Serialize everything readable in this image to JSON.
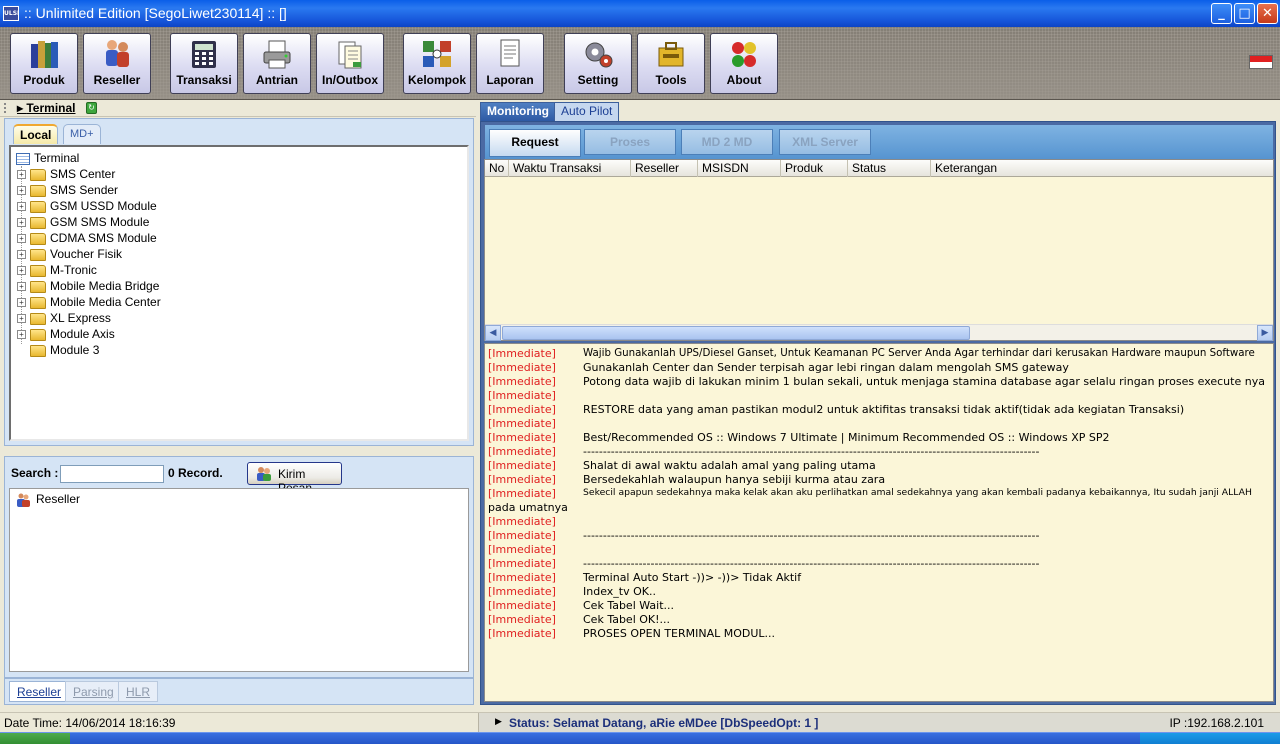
{
  "window": {
    "title": ":: Unlimited Edition [SegoLiwet230114] :: []",
    "app_icon_text": "ULSI",
    "controls": [
      "_",
      "□",
      "✕"
    ]
  },
  "toolbar": {
    "buttons": [
      {
        "label": "Produk",
        "icon": "books-icon"
      },
      {
        "label": "Reseller",
        "icon": "people-icon"
      },
      {
        "label": "Transaksi",
        "icon": "calculator-icon"
      },
      {
        "label": "Antrian",
        "icon": "printer-queue-icon"
      },
      {
        "label": "In/Outbox",
        "icon": "documents-icon"
      },
      {
        "label": "Kelompok",
        "icon": "network-group-icon"
      },
      {
        "label": "Laporan",
        "icon": "report-icon"
      },
      {
        "label": "Setting",
        "icon": "settings-gears-icon"
      },
      {
        "label": "Tools",
        "icon": "tools-icon"
      },
      {
        "label": "About",
        "icon": "about-balls-icon"
      }
    ],
    "flag": {
      "top_color": "#e02020",
      "bottom_color": "#ffffff"
    }
  },
  "left_panel": {
    "header_label": "Terminal",
    "tabs": [
      "Local",
      "MD+"
    ],
    "tree": {
      "root": "Terminal",
      "items": [
        {
          "label": "SMS Center",
          "expandable": true
        },
        {
          "label": "SMS Sender",
          "expandable": true
        },
        {
          "label": "GSM USSD Module",
          "expandable": true
        },
        {
          "label": "GSM SMS Module",
          "expandable": true
        },
        {
          "label": "CDMA SMS Module",
          "expandable": true
        },
        {
          "label": "Voucher Fisik",
          "expandable": true
        },
        {
          "label": "M-Tronic",
          "expandable": true
        },
        {
          "label": "Mobile Media Bridge",
          "expandable": true
        },
        {
          "label": "Mobile Media Center",
          "expandable": true
        },
        {
          "label": "XL Express",
          "expandable": true
        },
        {
          "label": "Module Axis",
          "expandable": true
        },
        {
          "label": "Module 3",
          "expandable": false
        }
      ]
    },
    "search": {
      "label": "Search :",
      "value": "",
      "record_count": "0 Record."
    },
    "kirim_button": "Kirim Pesan",
    "reseller_list": [
      "Reseller"
    ],
    "bottom_tabs": [
      "Reseller",
      "Parsing",
      "HLR"
    ]
  },
  "right_panel": {
    "tabs": [
      "Monitoring",
      "Auto Pilot"
    ],
    "sub_tabs": [
      "Request",
      "Proses",
      "MD 2 MD",
      "XML Server"
    ],
    "grid_columns": [
      "No",
      "Waktu Transaksi",
      "Reseller",
      "MSISDN",
      "Produk",
      "Status",
      "Keterangan"
    ],
    "log_tag": "[Immediate]",
    "log": [
      "Wajib Gunakanlah UPS/Diesel Ganset, Untuk Keamanan PC Server Anda Agar terhindar dari kerusakan Hardware maupun Software",
      "Gunakanlah Center dan Sender terpisah agar lebi ringan dalam mengolah SMS gateway",
      "Potong data wajib di lakukan minim 1 bulan sekali, untuk menjaga stamina database agar selalu ringan proses execute nya",
      "",
      "RESTORE data yang aman pastikan modul2 untuk aktifitas transaksi tidak aktif(tidak ada kegiatan Transaksi)",
      "",
      "Best/Recommended OS :: Windows 7 Ultimate | Minimum Recommended OS :: Windows XP SP2",
      "-------------------------------------------------------------------------------------------------------------------",
      "Shalat di awal waktu adalah amal yang paling utama",
      "Bersedekahlah walaupun hanya sebiji kurma atau zara",
      "Sekecil apapun sedekahnya maka kelak akan aku perlihatkan amal sedekahnya yang akan kembali padanya kebaikannya, Itu sudah janji ALLAH",
      "",
      "-------------------------------------------------------------------------------------------------------------------",
      "",
      "-------------------------------------------------------------------------------------------------------------------",
      "Terminal Auto Start -))>  -))> Tidak Aktif",
      "Index_tv OK..",
      "Cek Tabel Wait...",
      "Cek Tabel OK!...",
      "PROSES OPEN TERMINAL MODUL..."
    ],
    "log_wrap_continuation": "pada umatnya"
  },
  "statusbar": {
    "date_time": "Date Time: 14/06/2014 18:16:39",
    "status": "Status: Selamat Datang, aRie eMDee [DbSpeedOpt: 1 ]",
    "ip": "IP :192.168.2.101"
  }
}
